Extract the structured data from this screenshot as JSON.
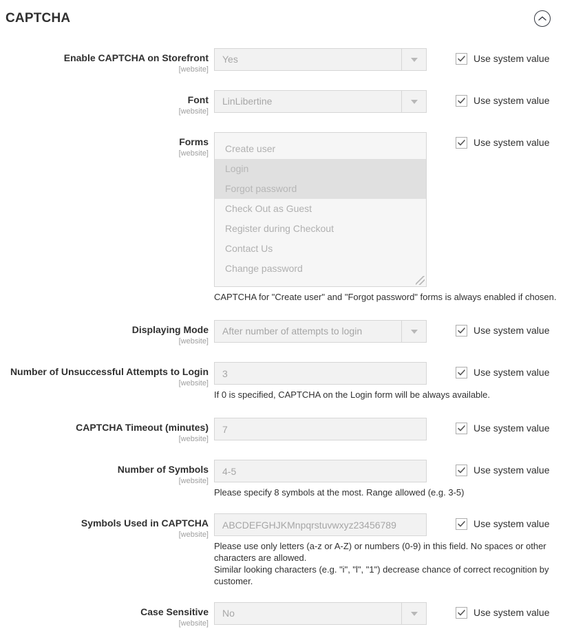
{
  "section": {
    "title": "CAPTCHA",
    "collapse_icon": "chevron-up-circle-icon"
  },
  "common": {
    "use_system_value_label": "Use system value",
    "scope_website": "[website]",
    "checkbox_checked": true
  },
  "fields": [
    {
      "id": "enable-captcha-on-storefront",
      "label": "Enable CAPTCHA on Storefront",
      "scope": "[website]",
      "type": "select",
      "value": "Yes",
      "use_system_value": "Use system value"
    },
    {
      "id": "font",
      "label": "Font",
      "scope": "[website]",
      "type": "select",
      "value": "LinLibertine",
      "use_system_value": "Use system value"
    },
    {
      "id": "forms",
      "label": "Forms",
      "scope": "[website]",
      "type": "multiselect",
      "options": [
        {
          "label": "Create user",
          "selected": false
        },
        {
          "label": "Login",
          "selected": true
        },
        {
          "label": "Forgot password",
          "selected": true
        },
        {
          "label": "Check Out as Guest",
          "selected": false
        },
        {
          "label": "Register during Checkout",
          "selected": false
        },
        {
          "label": "Contact Us",
          "selected": false
        },
        {
          "label": "Change password",
          "selected": false
        }
      ],
      "hint": "CAPTCHA for \"Create user\" and \"Forgot password\" forms is always enabled if chosen.",
      "use_system_value": "Use system value"
    },
    {
      "id": "displaying-mode",
      "label": "Displaying Mode",
      "scope": "[website]",
      "type": "select",
      "value": "After number of attempts to login",
      "use_system_value": "Use system value"
    },
    {
      "id": "number-of-unsuccessful-attempts-to-login",
      "label": "Number of Unsuccessful Attempts to Login",
      "scope": "[website]",
      "type": "text",
      "value": "3",
      "hint": "If 0 is specified, CAPTCHA on the Login form will be always available.",
      "use_system_value": "Use system value"
    },
    {
      "id": "captcha-timeout-minutes",
      "label": "CAPTCHA Timeout (minutes)",
      "scope": "[website]",
      "type": "text",
      "value": "7",
      "use_system_value": "Use system value"
    },
    {
      "id": "number-of-symbols",
      "label": "Number of Symbols",
      "scope": "[website]",
      "type": "text",
      "value": "4-5",
      "hint": "Please specify 8 symbols at the most. Range allowed (e.g. 3-5)",
      "use_system_value": "Use system value"
    },
    {
      "id": "symbols-used-in-captcha",
      "label": "Symbols Used in CAPTCHA",
      "scope": "[website]",
      "type": "text",
      "value": "ABCDEFGHJKMnpqrstuvwxyz23456789",
      "hint_lines": [
        "Please use only letters (a-z or A-Z) or numbers (0-9) in this field. No spaces or other characters are allowed.",
        "Similar looking characters (e.g. \"i\", \"l\", \"1\") decrease chance of correct recognition by customer."
      ],
      "use_system_value": "Use system value"
    },
    {
      "id": "case-sensitive",
      "label": "Case Sensitive",
      "scope": "[website]",
      "type": "select",
      "value": "No",
      "use_system_value": "Use system value"
    }
  ],
  "colors": {
    "text": "#303030",
    "muted": "#a6a6a6",
    "field_bg": "#f2f2f2",
    "field_border": "#d6d6d6",
    "selected_option_bg": "#e0e0e0"
  }
}
